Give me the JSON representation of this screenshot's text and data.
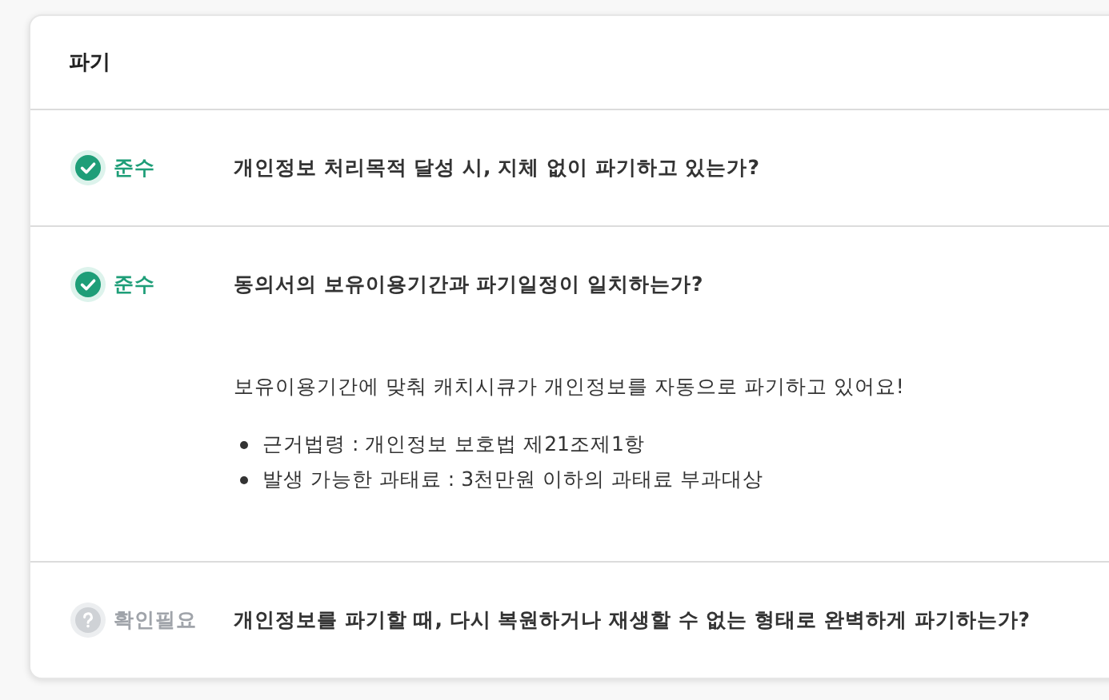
{
  "section": {
    "title": "파기"
  },
  "items": [
    {
      "kind": "compliant",
      "status": "준수",
      "question": "개인정보 처리목적 달성 시, 지체 없이 파기하고 있는가?"
    },
    {
      "kind": "compliant",
      "status": "준수",
      "question": "동의서의 보유이용기간과 파기일정이 일치하는가?",
      "detail": {
        "message": "보유이용기간에 맞춰 캐치시큐가 개인정보를 자동으로 파기하고 있어요!",
        "bullets": [
          "근거법령 : 개인정보 보호법 제21조제1항",
          "발생 가능한 과태료 : 3천만원 이하의 과태료 부과대상"
        ]
      }
    },
    {
      "kind": "check_needed",
      "status": "확인필요",
      "question": "개인정보를 파기할 때, 다시 복원하거나 재생할 수 없는 형태로 완벽하게 파기하는가?"
    }
  ]
}
